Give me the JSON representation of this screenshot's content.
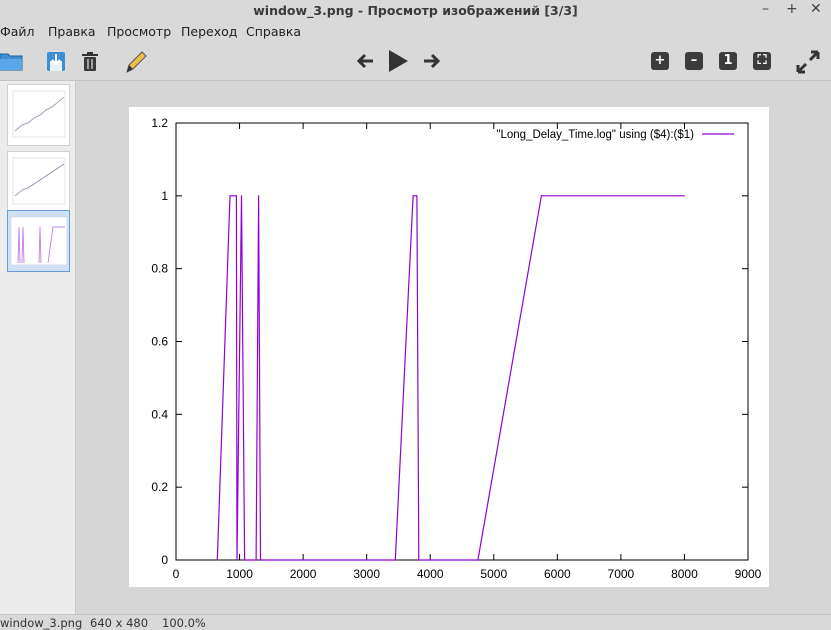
{
  "window": {
    "title": "window_3.png - Просмотр изображений [3/3]",
    "controls": [
      "–",
      "+",
      "✕"
    ]
  },
  "menu": [
    "Файл",
    "Правка",
    "Просмотр",
    "Переход",
    "Справка"
  ],
  "toolbar": {
    "icons": [
      "open-folder-icon",
      "save-icon",
      "trash-icon",
      "edit-pencil-icon",
      "previous-arrow-icon",
      "play-slideshow-icon",
      "next-arrow-icon",
      "zoom-in-icon",
      "zoom-out-icon",
      "zoom-1to1-icon",
      "zoom-fit-icon",
      "fullscreen-icon"
    ]
  },
  "thumbnails": [
    {
      "selected": false
    },
    {
      "selected": false
    },
    {
      "selected": true
    }
  ],
  "status": {
    "filename": "window_3.png",
    "dimensions": "640 x 480",
    "zoom": "100.0%"
  },
  "chart_data": {
    "type": "line",
    "title": "",
    "xlabel": "",
    "ylabel": "",
    "xlim": [
      0,
      9000
    ],
    "ylim": [
      0,
      1.2
    ],
    "x_ticks": [
      "0",
      "1000",
      "2000",
      "3000",
      "4000",
      "5000",
      "6000",
      "7000",
      "8000",
      "9000"
    ],
    "y_ticks": [
      "0",
      "0.2",
      "0.4",
      "0.6",
      "0.8",
      "1",
      "1.2"
    ],
    "grid": false,
    "legend_position": "top-right",
    "series": [
      {
        "name": "\"Long_Delay_Time.log\" using ($4):($1)",
        "color": "#9400d3",
        "x": [
          650,
          850,
          950,
          960,
          1030,
          1080,
          1260,
          1300,
          1330,
          3450,
          3730,
          3790,
          3820,
          4750,
          5750,
          8000
        ],
        "y": [
          0,
          1,
          1,
          0,
          1,
          0,
          0,
          1,
          0,
          0,
          1,
          1,
          0,
          0,
          1,
          1
        ]
      }
    ]
  }
}
